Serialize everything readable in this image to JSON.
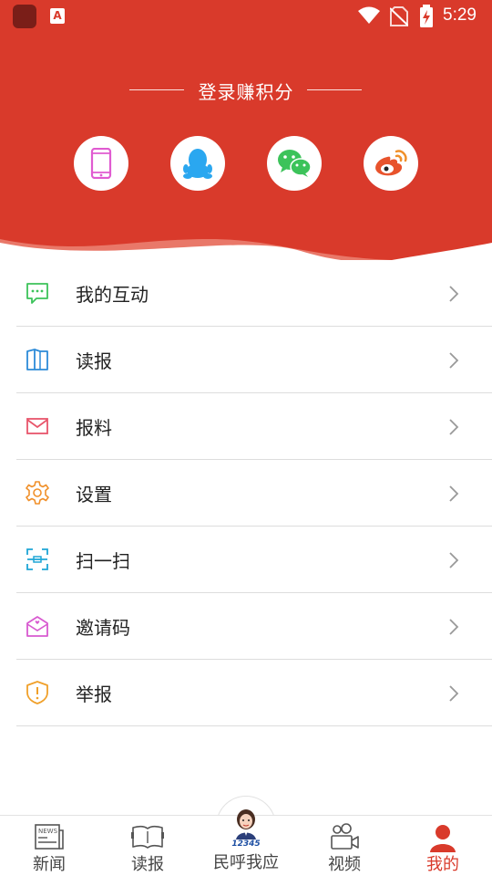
{
  "status_bar": {
    "time": "5:29",
    "app_badge": "A"
  },
  "header": {
    "login_title": "登录赚积分",
    "social_logins": [
      {
        "icon": "phone-icon",
        "color": "#e05bd1"
      },
      {
        "icon": "qq-icon",
        "color": "#2aa7f0"
      },
      {
        "icon": "wechat-icon",
        "color": "#3cc35a"
      },
      {
        "icon": "weibo-icon",
        "color": "#e8532c"
      }
    ],
    "background_color": "#d93a2b"
  },
  "menu": {
    "items": [
      {
        "label": "我的互动",
        "icon": "chat-icon",
        "color": "#3cc35a"
      },
      {
        "label": "读报",
        "icon": "newspaper-book-icon",
        "color": "#2c8bd8"
      },
      {
        "label": "报料",
        "icon": "mail-icon",
        "color": "#e8566b"
      },
      {
        "label": "设置",
        "icon": "gear-icon",
        "color": "#f0902a"
      },
      {
        "label": "扫一扫",
        "icon": "scan-icon",
        "color": "#1ea6d6"
      },
      {
        "label": "邀请码",
        "icon": "invite-icon",
        "color": "#d85ad0"
      },
      {
        "label": "举报",
        "icon": "report-shield-icon",
        "color": "#f0a02a"
      }
    ]
  },
  "bottom_nav": {
    "items": [
      {
        "label": "新闻",
        "icon": "news-icon",
        "active": false
      },
      {
        "label": "读报",
        "icon": "paper-icon",
        "active": false
      },
      {
        "label": "民呼我应",
        "icon": "service-avatar-icon",
        "active": false,
        "avatar_text": "12345"
      },
      {
        "label": "视频",
        "icon": "video-icon",
        "active": false
      },
      {
        "label": "我的",
        "icon": "profile-icon",
        "active": true
      }
    ],
    "active_color": "#d93a2b"
  }
}
